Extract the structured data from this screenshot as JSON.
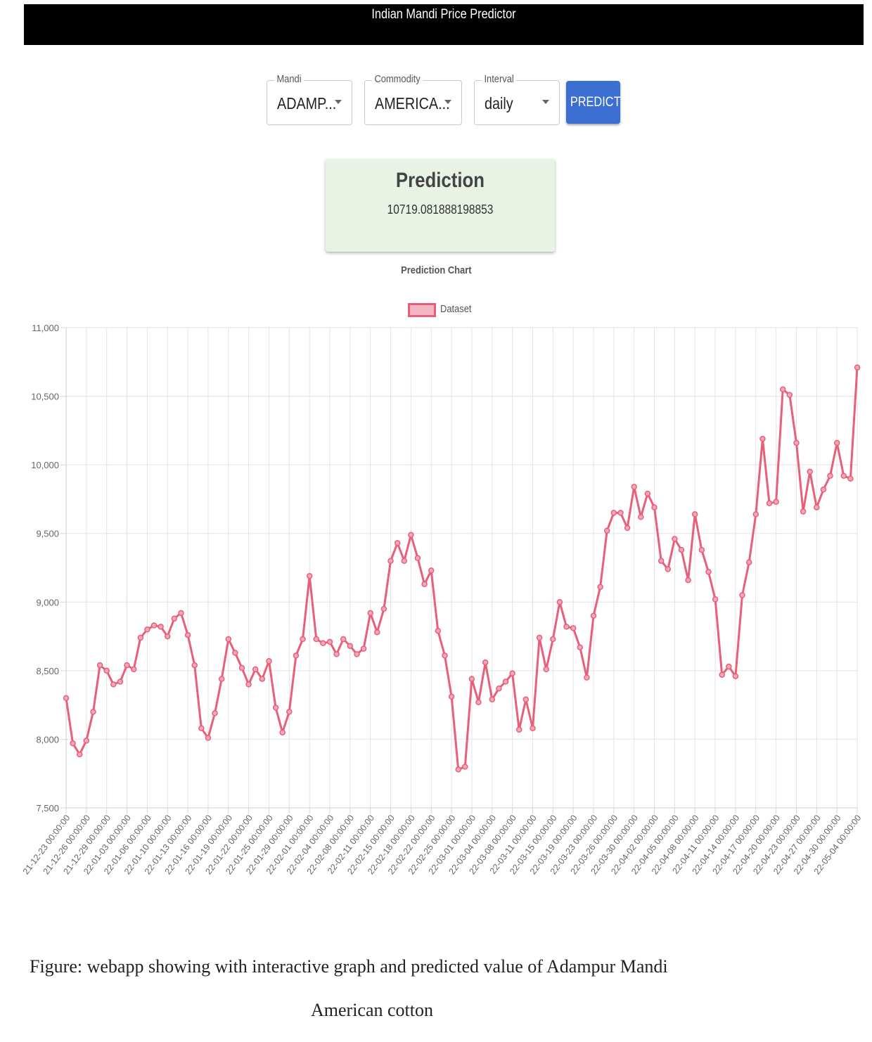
{
  "app": {
    "title": "Indian Mandi Price Predictor"
  },
  "form": {
    "mandi": {
      "label": "Mandi",
      "value": "ADAMP..."
    },
    "commodity": {
      "label": "Commodity",
      "value": "AMERICA..."
    },
    "interval": {
      "label": "Interval",
      "value": "daily"
    },
    "predict_label": "PREDICT"
  },
  "prediction": {
    "heading": "Prediction",
    "value": "10719.081888198853"
  },
  "chart": {
    "title": "Prediction Chart",
    "legend_label": "Dataset",
    "color": "#e85f7a"
  },
  "chart_data": {
    "type": "line",
    "title": "Prediction Chart",
    "xlabel": "",
    "ylabel": "",
    "ylim": [
      7500,
      11000
    ],
    "yticks": [
      "7,500",
      "8,000",
      "8,500",
      "9,000",
      "9,500",
      "10,000",
      "10,500",
      "11,000"
    ],
    "grid": true,
    "legend_position": "top",
    "xtick_labels": [
      "21-12-23 00:00:00",
      "21-12-26 00:00:00",
      "21-12-29 00:00:00",
      "22-01-03 00:00:00",
      "22-01-06 00:00:00",
      "22-01-10 00:00:00",
      "22-01-13 00:00:00",
      "22-01-16 00:00:00",
      "22-01-19 00:00:00",
      "22-01-22 00:00:00",
      "22-01-25 00:00:00",
      "22-01-29 00:00:00",
      "22-02-01 00:00:00",
      "22-02-04 00:00:00",
      "22-02-08 00:00:00",
      "22-02-11 00:00:00",
      "22-02-15 00:00:00",
      "22-02-18 00:00:00",
      "22-02-22 00:00:00",
      "22-02-25 00:00:00",
      "22-03-01 00:00:00",
      "22-03-04 00:00:00",
      "22-03-08 00:00:00",
      "22-03-11 00:00:00",
      "22-03-15 00:00:00",
      "22-03-19 00:00:00",
      "22-03-23 00:00:00",
      "22-03-26 00:00:00",
      "22-03-30 00:00:00",
      "22-04-02 00:00:00",
      "22-04-05 00:00:00",
      "22-04-08 00:00:00",
      "22-04-11 00:00:00",
      "22-04-14 00:00:00",
      "22-04-17 00:00:00",
      "22-04-20 00:00:00",
      "22-04-23 00:00:00",
      "22-04-27 00:00:00",
      "22-04-30 00:00:00",
      "22-05-04 00:00:00"
    ],
    "series": [
      {
        "name": "Dataset",
        "values": [
          8300,
          7970,
          7890,
          7990,
          8200,
          8540,
          8500,
          8400,
          8420,
          8540,
          8510,
          8740,
          8800,
          8830,
          8820,
          8750,
          8880,
          8920,
          8760,
          8540,
          8080,
          8010,
          8190,
          8440,
          8730,
          8630,
          8520,
          8400,
          8510,
          8440,
          8570,
          8230,
          8050,
          8200,
          8610,
          8730,
          9190,
          8730,
          8700,
          8710,
          8620,
          8730,
          8680,
          8620,
          8660,
          8920,
          8780,
          8950,
          9300,
          9430,
          9300,
          9490,
          9320,
          9130,
          9230,
          8790,
          8610,
          8310,
          7780,
          7800,
          8440,
          8270,
          8560,
          8290,
          8370,
          8420,
          8480,
          8070,
          8290,
          8080,
          8740,
          8510,
          8730,
          9000,
          8820,
          8810,
          8670,
          8450,
          8900,
          9110,
          9520,
          9650,
          9650,
          9540,
          9840,
          9620,
          9790,
          9690,
          9300,
          9240,
          9460,
          9380,
          9160,
          9640,
          9380,
          9220,
          9020,
          8470,
          8530,
          8460,
          9050,
          9290,
          9640,
          10190,
          9720,
          9730,
          10550,
          10510,
          10160,
          9660,
          9950,
          9690,
          9820,
          9920,
          10160,
          9920,
          9900,
          10710
        ]
      }
    ]
  },
  "caption": {
    "line1": "Figure: webapp showing with interactive graph and predicted value of Adampur Mandi",
    "line2": "American cotton"
  }
}
